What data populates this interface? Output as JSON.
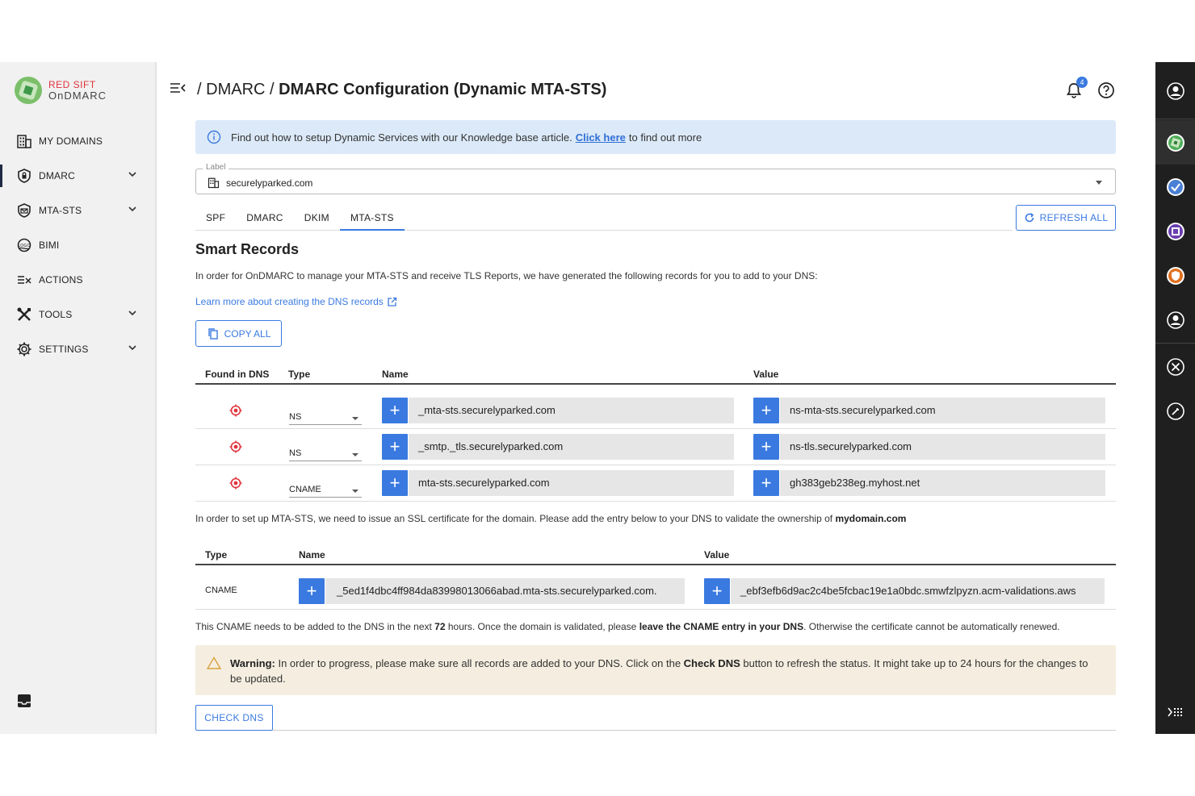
{
  "brand": {
    "line1": "RED SIFT",
    "line2": "OnDMARC"
  },
  "sidebar": {
    "items": [
      {
        "label": "MY DOMAINS",
        "icon": "building-icon",
        "chevron": false
      },
      {
        "label": "DMARC",
        "icon": "shield-lock-icon",
        "chevron": true
      },
      {
        "label": "MTA-STS",
        "icon": "shield-mail-icon",
        "chevron": true
      },
      {
        "label": "BIMI",
        "icon": "bimi-logo-icon",
        "chevron": false
      },
      {
        "label": "ACTIONS",
        "icon": "actions-list-icon",
        "chevron": false
      },
      {
        "label": "TOOLS",
        "icon": "tools-icon",
        "chevron": true
      },
      {
        "label": "SETTINGS",
        "icon": "gear-icon",
        "chevron": true
      }
    ]
  },
  "header": {
    "crumb_sep": "/",
    "crumb1": "DMARC",
    "crumb2": "DMARC Configuration (Dynamic MTA-STS)",
    "notif_count": "4"
  },
  "banner": {
    "text_before": "Find out how to setup Dynamic Services with our Knowledge base article.",
    "link": "Click here",
    "text_after": "to find out more"
  },
  "domain_select": {
    "label": "Label",
    "value": "securelyparked.com"
  },
  "tabs": [
    "SPF",
    "DMARC",
    "DKIM",
    "MTA-STS"
  ],
  "active_tab": "MTA-STS",
  "refresh_label": "REFRESH ALL",
  "smart": {
    "title": "Smart Records",
    "intro": "In order for OnDMARC to manage your MTA-STS and receive TLS Reports, we have generated the following records for you to add to your DNS:",
    "learn_link": "Learn more about creating the DNS records",
    "copy_label": "COPY ALL",
    "headers": {
      "found": "Found in DNS",
      "type": "Type",
      "name": "Name",
      "value": "Value"
    },
    "rows": [
      {
        "type": "NS",
        "name": "_mta-sts.securelyparked.com",
        "value": "ns-mta-sts.securelyparked.com"
      },
      {
        "type": "NS",
        "name": "_smtp._tls.securelyparked.com",
        "value": "ns-tls.securelyparked.com"
      },
      {
        "type": "CNAME",
        "name": "mta-sts.securelyparked.com",
        "value": "gh383geb238eg.myhost.net"
      }
    ]
  },
  "ssl": {
    "text": "In order to set up MTA-STS, we need to issue an SSL certificate for the domain. Please add the entry below to your DNS to validate the ownership of",
    "domain": "mydomain.com",
    "headers": {
      "type": "Type",
      "name": "Name",
      "value": "Value"
    },
    "row": {
      "type": "CNAME",
      "name": "_5ed1f4dbc4ff984da83998013066abad.mta-sts.securelyparked.com.",
      "value": "_ebf3efb6d9ac2c4be5fcbac19e1a0bdc.smwfzlpyzn.acm-validations.aws"
    }
  },
  "cname_note": {
    "t1": "This CNAME needs to be added to the DNS in the next",
    "hours": "72",
    "t2": "hours. Once the domain is validated, please",
    "bold": "leave the CNAME entry in your DNS",
    "t3": ". Otherwise the certificate cannot be automatically renewed."
  },
  "warning": {
    "label": "Warning:",
    "t1": "In order to progress, please make sure all records are added to your DNS. Click on the",
    "bold": "Check DNS",
    "t2": "button to refresh the status. It might take up to 24 hours for the changes to be updated."
  },
  "check_label": "CHECK DNS",
  "colors": {
    "accent": "#3a7ae0",
    "danger": "#e0333c",
    "rail": "#1f1f1f",
    "banner": "#dce9f8",
    "warn": "#f5eee0"
  }
}
